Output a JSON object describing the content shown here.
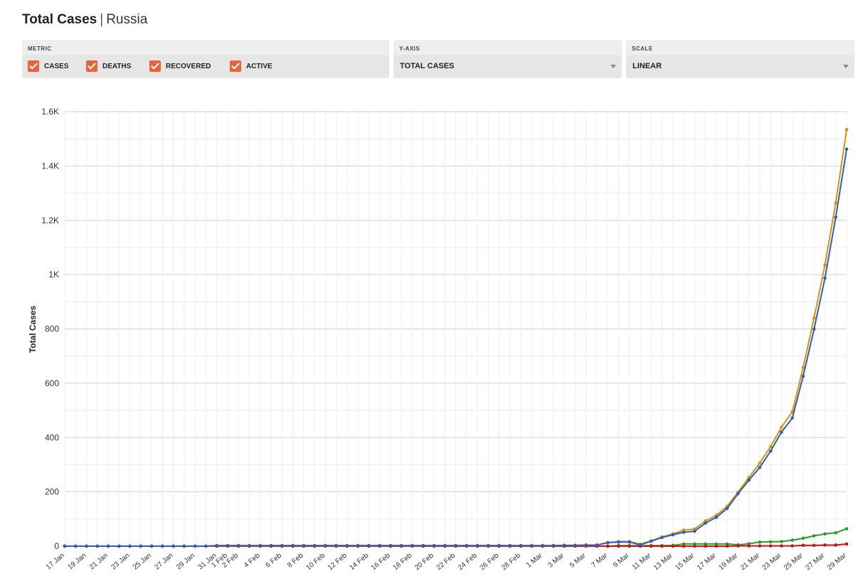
{
  "header": {
    "title": "Total Cases",
    "separator": "|",
    "country": "Russia"
  },
  "controls": {
    "metric": {
      "caption": "METRIC",
      "options": [
        {
          "label": "CASES",
          "checked": true
        },
        {
          "label": "DEATHS",
          "checked": true
        },
        {
          "label": "RECOVERED",
          "checked": true
        },
        {
          "label": "ACTIVE",
          "checked": true
        }
      ]
    },
    "yaxis": {
      "caption": "Y-AXIS",
      "value": "TOTAL CASES"
    },
    "scale": {
      "caption": "SCALE",
      "value": "LINEAR"
    }
  },
  "colors": {
    "checkbox": "#e8623a",
    "cases": "#d9920b",
    "deaths": "#cc1111",
    "recovered": "#2e9a2e",
    "active": "#2f5fb3"
  },
  "chart_data": {
    "type": "line",
    "title": "",
    "xlabel": "",
    "ylabel": "Total Cases",
    "ylim": [
      0,
      1600
    ],
    "yticks": [
      0,
      200,
      400,
      600,
      800,
      1000,
      1200,
      1400,
      1600
    ],
    "ytick_labels": [
      "0",
      "200",
      "400",
      "600",
      "800",
      "1K",
      "1.2K",
      "1.4K",
      "1.6K"
    ],
    "grid": true,
    "x": [
      "17 Jan",
      "18 Jan",
      "19 Jan",
      "20 Jan",
      "21 Jan",
      "22 Jan",
      "23 Jan",
      "24 Jan",
      "25 Jan",
      "26 Jan",
      "27 Jan",
      "28 Jan",
      "29 Jan",
      "30 Jan",
      "31 Jan",
      "1 Feb",
      "2 Feb",
      "3 Feb",
      "4 Feb",
      "5 Feb",
      "6 Feb",
      "7 Feb",
      "8 Feb",
      "9 Feb",
      "10 Feb",
      "11 Feb",
      "12 Feb",
      "13 Feb",
      "14 Feb",
      "15 Feb",
      "16 Feb",
      "17 Feb",
      "18 Feb",
      "19 Feb",
      "20 Feb",
      "21 Feb",
      "22 Feb",
      "23 Feb",
      "24 Feb",
      "25 Feb",
      "26 Feb",
      "27 Feb",
      "28 Feb",
      "29 Feb",
      "1 Mar",
      "2 Mar",
      "3 Mar",
      "4 Mar",
      "5 Mar",
      "6 Mar",
      "7 Mar",
      "8 Mar",
      "9 Mar",
      "10 Mar",
      "11 Mar",
      "12 Mar",
      "13 Mar",
      "14 Mar",
      "15 Mar",
      "16 Mar",
      "17 Mar",
      "18 Mar",
      "19 Mar",
      "20 Mar",
      "21 Mar",
      "22 Mar",
      "23 Mar",
      "24 Mar",
      "25 Mar",
      "26 Mar",
      "27 Mar",
      "28 Mar",
      "29 Mar"
    ],
    "xtick_labels": [
      "17 Jan",
      "19 Jan",
      "21 Jan",
      "23 Jan",
      "25 Jan",
      "27 Jan",
      "29 Jan",
      "31 Jan",
      "1 Feb",
      "2 Feb",
      "4 Feb",
      "6 Feb",
      "8 Feb",
      "10 Feb",
      "12 Feb",
      "14 Feb",
      "16 Feb",
      "18 Feb",
      "20 Feb",
      "22 Feb",
      "24 Feb",
      "26 Feb",
      "28 Feb",
      "1 Mar",
      "3 Mar",
      "5 Mar",
      "7 Mar",
      "9 Mar",
      "11 Mar",
      "13 Mar",
      "15 Mar",
      "17 Mar",
      "19 Mar",
      "21 Mar",
      "23 Mar",
      "25 Mar",
      "27 Mar",
      "29 Mar"
    ],
    "series": [
      {
        "name": "Cases",
        "color": "#d9920b",
        "values": [
          0,
          0,
          0,
          0,
          0,
          0,
          0,
          0,
          0,
          0,
          0,
          0,
          0,
          0,
          2,
          2,
          2,
          2,
          2,
          2,
          2,
          2,
          2,
          2,
          2,
          2,
          2,
          2,
          2,
          2,
          2,
          2,
          2,
          2,
          2,
          2,
          2,
          2,
          2,
          2,
          2,
          2,
          2,
          2,
          2,
          2,
          3,
          3,
          4,
          4,
          13,
          17,
          17,
          7,
          20,
          34,
          45,
          59,
          63,
          93,
          114,
          147,
          199,
          253,
          306,
          367,
          438,
          495,
          658,
          840,
          1036,
          1264,
          1534
        ]
      },
      {
        "name": "Deaths",
        "color": "#cc1111",
        "values": [
          0,
          0,
          0,
          0,
          0,
          0,
          0,
          0,
          0,
          0,
          0,
          0,
          0,
          0,
          0,
          0,
          0,
          0,
          0,
          0,
          0,
          0,
          0,
          0,
          0,
          0,
          0,
          0,
          0,
          0,
          0,
          0,
          0,
          0,
          0,
          0,
          0,
          0,
          0,
          0,
          0,
          0,
          0,
          0,
          0,
          0,
          0,
          0,
          0,
          0,
          0,
          0,
          0,
          0,
          0,
          0,
          0,
          0,
          0,
          0,
          0,
          0,
          1,
          1,
          1,
          1,
          1,
          1,
          3,
          3,
          4,
          4,
          8
        ]
      },
      {
        "name": "Recovered",
        "color": "#2e9a2e",
        "values": [
          0,
          0,
          0,
          0,
          0,
          0,
          0,
          0,
          0,
          0,
          0,
          0,
          0,
          0,
          0,
          0,
          0,
          0,
          0,
          0,
          0,
          0,
          0,
          0,
          0,
          0,
          0,
          0,
          0,
          0,
          0,
          0,
          0,
          0,
          0,
          0,
          0,
          0,
          0,
          0,
          0,
          0,
          0,
          0,
          0,
          0,
          0,
          0,
          0,
          0,
          0,
          2,
          2,
          2,
          2,
          2,
          3,
          8,
          8,
          8,
          8,
          8,
          5,
          9,
          15,
          16,
          17,
          22,
          29,
          38,
          45,
          49,
          64
        ]
      },
      {
        "name": "Active",
        "color": "#2f5fb3",
        "values": [
          0,
          0,
          0,
          0,
          0,
          0,
          0,
          0,
          0,
          0,
          0,
          0,
          0,
          0,
          2,
          2,
          2,
          2,
          2,
          2,
          2,
          2,
          2,
          2,
          2,
          2,
          2,
          2,
          2,
          2,
          2,
          2,
          2,
          2,
          2,
          2,
          2,
          2,
          2,
          2,
          2,
          2,
          2,
          2,
          2,
          2,
          3,
          3,
          4,
          4,
          13,
          15,
          15,
          5,
          18,
          32,
          42,
          51,
          55,
          85,
          106,
          139,
          193,
          243,
          290,
          350,
          420,
          472,
          626,
          799,
          987,
          1211,
          1462
        ]
      }
    ]
  }
}
